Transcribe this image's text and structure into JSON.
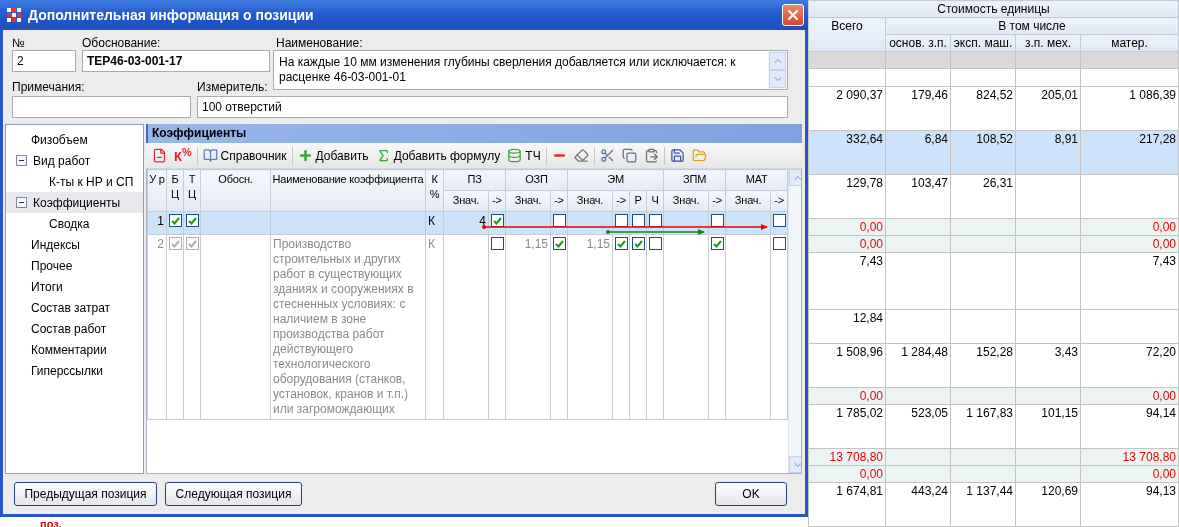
{
  "dialog": {
    "title": "Дополнительная информация о позиции",
    "fields": {
      "number_label": "№",
      "number": "2",
      "basis_label": "Обоснование:",
      "basis": "ТЕР46-03-001-17",
      "name_label": "Наименование:",
      "name": "На каждые 10 мм изменения глубины сверления добавляется или исключается: к расценке 46-03-001-01",
      "notes_label": "Примечания:",
      "unit_label": "Измеритель:",
      "unit": "100 отверстий"
    },
    "tree": [
      {
        "label": "Физобъем",
        "selected": false
      },
      {
        "label": "Вид работ",
        "selected": false,
        "expanded": true,
        "children": [
          {
            "label": "К-ты к НР и СП",
            "selected": false
          }
        ]
      },
      {
        "label": "Коэффициенты",
        "selected": true,
        "expanded": true,
        "children": [
          {
            "label": "Сводка",
            "selected": false
          }
        ]
      },
      {
        "label": "Индексы",
        "selected": false
      },
      {
        "label": "Прочее",
        "selected": false
      },
      {
        "label": "Итоги",
        "selected": false
      },
      {
        "label": "Состав затрат",
        "selected": false
      },
      {
        "label": "Состав работ",
        "selected": false
      },
      {
        "label": "Комментарии",
        "selected": false
      },
      {
        "label": "Гиперссылки",
        "selected": false
      }
    ],
    "coefficients": {
      "title": "Коэффициенты",
      "toolbar": {
        "coef_glyph": "К$^{%}$",
        "reference": "Справочник",
        "add": "Добавить",
        "add_formula": "Добавить формулу",
        "tch": "ТЧ"
      },
      "headers": {
        "level": "У р",
        "bc": "Б Ц",
        "tc": "Т Ц",
        "basis": "Обосн.",
        "name": "Наименование коэффициента",
        "k": "К %"
      },
      "groups": [
        {
          "title": "ПЗ",
          "subs": [
            "Знач.",
            "->"
          ]
        },
        {
          "title": "ОЗП",
          "subs": [
            "Знач.",
            "->"
          ]
        },
        {
          "title": "ЭМ",
          "subs": [
            "Знач.",
            "->",
            "Р",
            "Ч"
          ]
        },
        {
          "title": "ЗПМ",
          "subs": [
            "Знач.",
            "->"
          ]
        },
        {
          "title": "МАТ",
          "subs": [
            "Знач.",
            "->"
          ]
        }
      ],
      "rows": [
        {
          "level": "1",
          "bc": true,
          "tc": true,
          "k": "К",
          "selected": true,
          "disabled": false,
          "groups": [
            {
              "value": "4",
              "checks": [
                true
              ]
            },
            {
              "checks": [
                false
              ]
            },
            {
              "checks": [
                false,
                false,
                false
              ]
            },
            {
              "checks": [
                false
              ]
            },
            {
              "checks": [
                false
              ]
            }
          ]
        },
        {
          "level": "2",
          "bc": true,
          "tc": true,
          "name": "Производство строительных и других работ в существующих зданиях и сооружениях в стесненных условиях: с наличием в зоне производства работ действующего технологического оборудования (станков, установок, кранов и т.п.) или загромождающих",
          "k": "К",
          "selected": false,
          "disabled": true,
          "groups": [
            {
              "checks": [
                false
              ]
            },
            {
              "value": "1,15",
              "checks": [
                true
              ]
            },
            {
              "value": "1,15",
              "checks": [
                true,
                true,
                false
              ]
            },
            {
              "checks": [
                true
              ]
            },
            {
              "checks": [
                false
              ]
            }
          ]
        }
      ]
    },
    "buttons": {
      "previous": "Предыдущая позиция",
      "next": "Следующая позиция",
      "ok": "OK"
    }
  },
  "background": {
    "footer_text": "поз.",
    "table": {
      "title": "Стоимость единицы",
      "group": "В том числе",
      "columns": [
        "Всего",
        "основ. з.п.",
        "эксп. маш.",
        "з.п. мех.",
        "матер."
      ],
      "rows": [
        {
          "kind": "band",
          "selected": false,
          "cells": []
        },
        {
          "kind": "blank",
          "selected": false,
          "cells": []
        },
        {
          "kind": "item",
          "selected": false,
          "cells": [
            "2 090,37",
            "179,46",
            "824,52",
            "205,01",
            "1 086,39"
          ]
        },
        {
          "kind": "item",
          "selected": true,
          "cells": [
            "332,64",
            "6,84",
            "108,52",
            "8,91",
            "217,28"
          ]
        },
        {
          "kind": "item",
          "selected": false,
          "cells": [
            "129,78",
            "103,47",
            "26,31",
            null,
            null
          ]
        },
        {
          "kind": "total",
          "selected": false,
          "cells": [
            "0,00",
            null,
            null,
            null,
            "0,00"
          ]
        },
        {
          "kind": "total",
          "selected": false,
          "cells": [
            "0,00",
            null,
            null,
            null,
            "0,00"
          ]
        },
        {
          "kind": "tall",
          "selected": false,
          "cells": [
            "7,43",
            null,
            null,
            null,
            "7,43"
          ]
        },
        {
          "kind": "short",
          "selected": false,
          "cells": [
            "12,84",
            null,
            null,
            null,
            null
          ]
        },
        {
          "kind": "item",
          "selected": false,
          "cells": [
            "1 508,96",
            "1 284,48",
            "152,28",
            "3,43",
            "72,20"
          ]
        },
        {
          "kind": "total",
          "selected": false,
          "cells": [
            "0,00",
            null,
            null,
            null,
            "0,00"
          ]
        },
        {
          "kind": "item",
          "selected": false,
          "cells": [
            "1 785,02",
            "523,05",
            "1 167,83",
            "101,15",
            "94,14"
          ]
        },
        {
          "kind": "total",
          "selected": false,
          "cells": [
            "13 708,80",
            null,
            null,
            null,
            "13 708,80"
          ]
        },
        {
          "kind": "total",
          "selected": false,
          "cells": [
            "0,00",
            null,
            null,
            null,
            "0,00"
          ]
        },
        {
          "kind": "item",
          "selected": false,
          "cells": [
            "1 674,81",
            "443,24",
            "1 137,44",
            "120,69",
            "94,13"
          ]
        }
      ]
    }
  }
}
